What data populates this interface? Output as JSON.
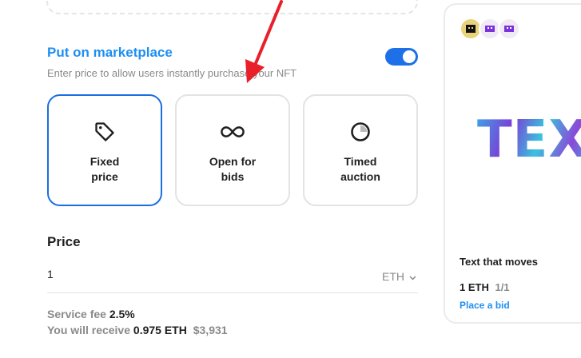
{
  "marketplace": {
    "title": "Put on marketplace",
    "subtitle": "Enter price to allow users instantly purchase your NFT",
    "toggle_on": true,
    "options": [
      {
        "label": "Fixed\nprice",
        "icon": "tag-icon",
        "selected": true
      },
      {
        "label": "Open for\nbids",
        "icon": "infinity-icon",
        "selected": false
      },
      {
        "label": "Timed\nauction",
        "icon": "timer-icon",
        "selected": false
      }
    ]
  },
  "price": {
    "label": "Price",
    "value": "1",
    "currency": "ETH"
  },
  "fees": {
    "service_label": "Service fee",
    "service_value": "2.5%",
    "receive_label": "You will receive",
    "receive_eth": "0.975 ETH",
    "receive_usd": "$3,931"
  },
  "preview": {
    "art_text": "TEX",
    "name": "Text that moves",
    "price": "1 ETH",
    "quantity": "1/1",
    "bid_label": "Place a bid"
  },
  "colors": {
    "accent": "#1e8ef3",
    "selected_border": "#1a6ee3",
    "annotation_arrow": "#e8202a"
  }
}
